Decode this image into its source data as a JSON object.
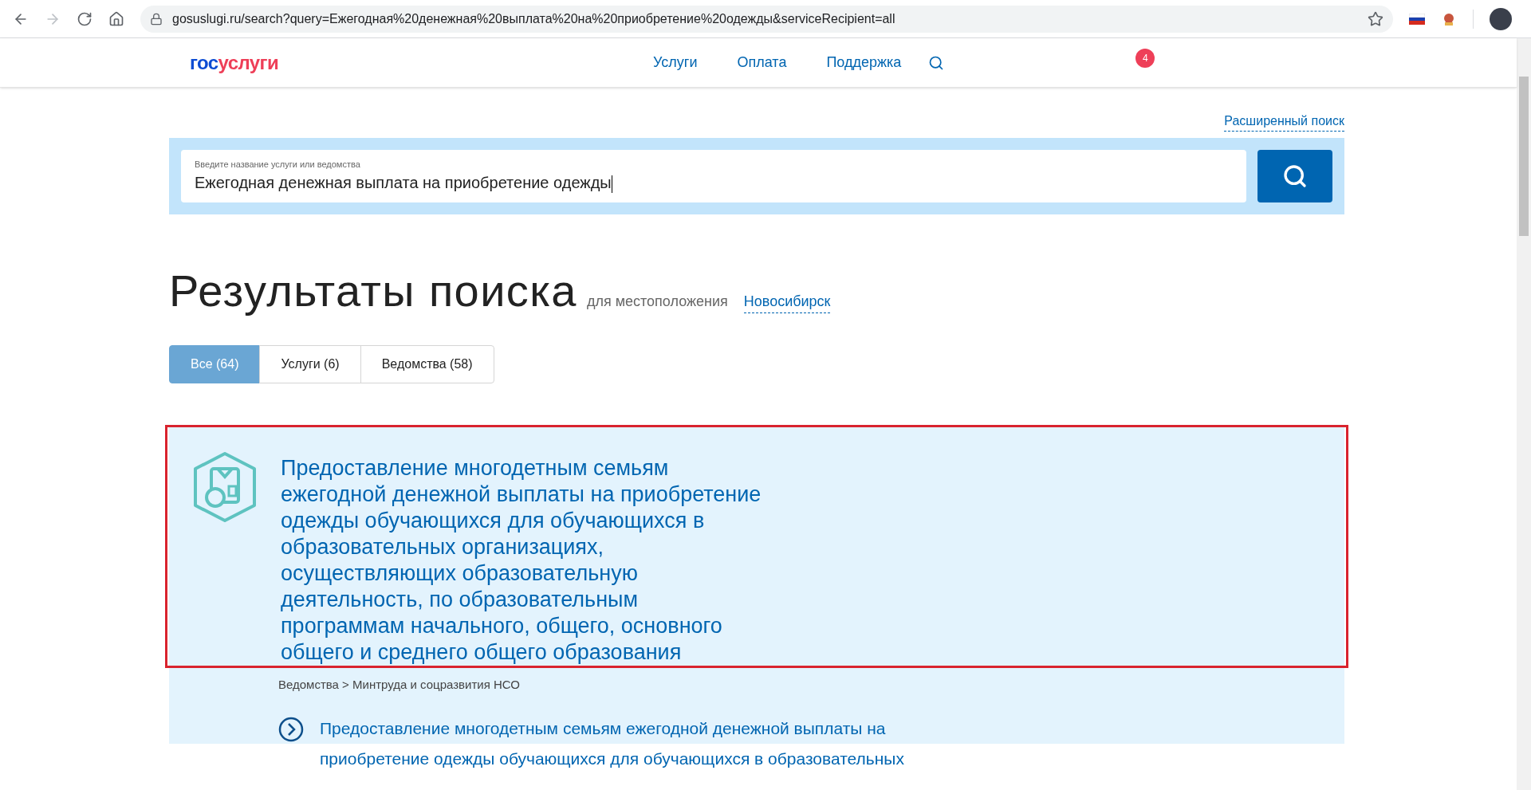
{
  "browser": {
    "url": "gosuslugi.ru/search?query=Ежегодная%20денежная%20выплата%20на%20приобретение%20одежды&serviceRecipient=all"
  },
  "header": {
    "logo_parts": [
      "гос",
      "услуги"
    ],
    "nav": [
      "Услуги",
      "Оплата",
      "Поддержка"
    ],
    "notification_count": "4"
  },
  "advanced_search": "Расширенный поиск",
  "search": {
    "label": "Введите название услуги или ведомства",
    "value": "Ежегодная денежная выплата на приобретение одежды"
  },
  "results_heading": {
    "title": "Результаты поиска",
    "location_label": "для местоположения",
    "location": "Новосибирск"
  },
  "tabs": [
    {
      "label": "Все (64)",
      "selected": true
    },
    {
      "label": "Услуги (6)",
      "selected": false
    },
    {
      "label": "Ведомства (58)",
      "selected": false
    }
  ],
  "result": {
    "highlighted": true,
    "title_lines": [
      "Предоставление многодетным семьям",
      "ежегодной денежной выплаты на приобретение",
      "одежды обучающихся для обучающихся в",
      "образовательных организациях,",
      "осуществляющих образовательную",
      "деятельность, по образовательным",
      "программам начального, общего, основного",
      "общего и среднего общего образования"
    ],
    "breadcrumb": "Ведомства > Минтруда и соцразвития НСО",
    "sub_link_lines": [
      "Предоставление многодетным семьям ежегодной денежной выплаты на",
      "приобретение одежды обучающихся для обучающихся в образовательных"
    ]
  }
}
